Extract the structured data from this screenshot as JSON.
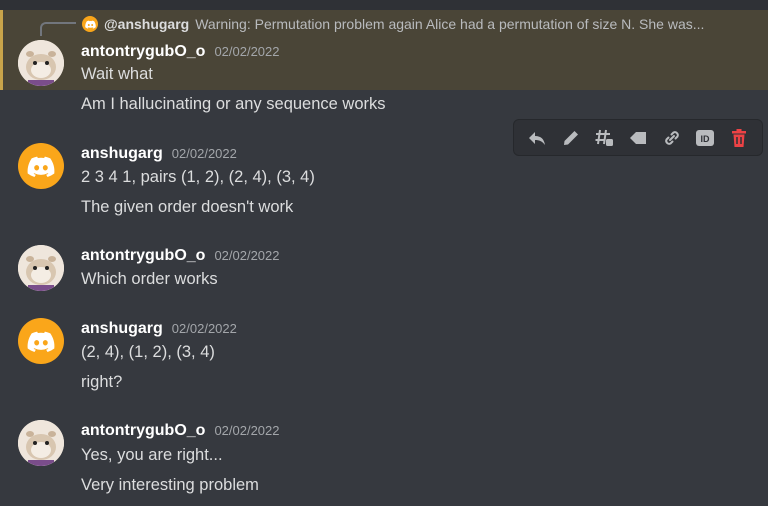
{
  "reply": {
    "author": "@anshugarg",
    "text": "Warning: Permutation problem again  Alice had a permutation of size N. She was..."
  },
  "messages": [
    {
      "author": "antontrygubO_o",
      "timestamp": "02/02/2022",
      "avatar": "photo",
      "lines": [
        "Wait what",
        "Am I hallucinating or any sequence works"
      ]
    },
    {
      "author": "anshugarg",
      "timestamp": "02/02/2022",
      "avatar": "discord",
      "lines": [
        "2 3 4 1, pairs (1, 2), (2, 4), (3, 4)",
        "The given order doesn't work"
      ]
    },
    {
      "author": "antontrygubO_o",
      "timestamp": "02/02/2022",
      "avatar": "photo",
      "lines": [
        "Which order works"
      ]
    },
    {
      "author": "anshugarg",
      "timestamp": "02/02/2022",
      "avatar": "discord",
      "lines": [
        "(2, 4), (1, 2), (3, 4)",
        "right?"
      ]
    },
    {
      "author": "antontrygubO_o",
      "timestamp": "02/02/2022",
      "avatar": "photo",
      "lines": [
        "Yes, you are right...",
        "Very interesting problem"
      ]
    }
  ],
  "toolbar": {
    "icons": [
      "reply-icon",
      "edit-pencil-icon",
      "create-thread-icon",
      "tag-icon",
      "copy-link-icon",
      "copy-id-icon",
      "delete-icon"
    ],
    "id_badge": "ID",
    "delete_color": "#ed4245"
  },
  "colors": {
    "highlight": "#4a4537",
    "highlight_border": "#c9a44a",
    "discord_avatar": "#faa61a"
  }
}
